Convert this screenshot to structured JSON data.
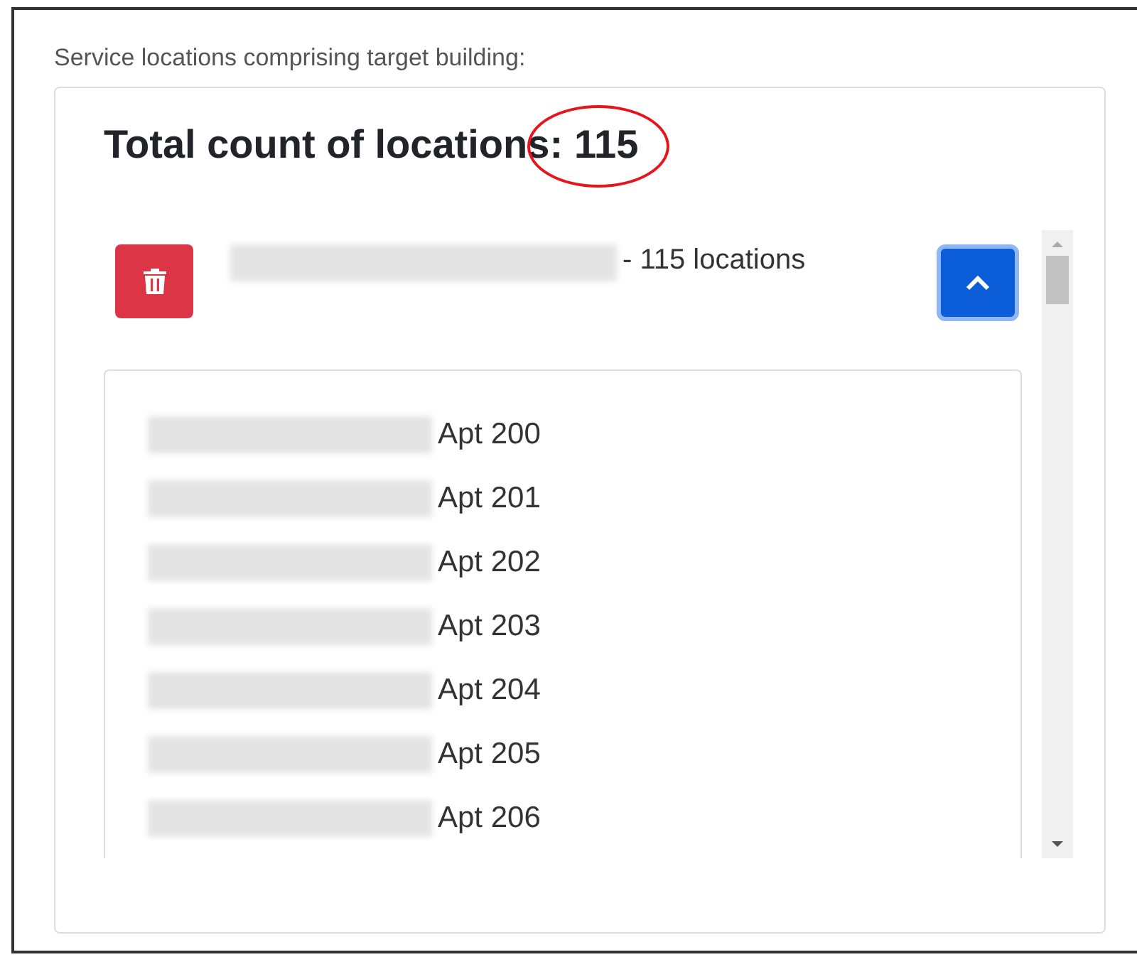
{
  "label": "Service locations comprising target building:",
  "heading": {
    "text": "Total count of locations:",
    "count": "115",
    "count_circled": true
  },
  "group": {
    "summary": "- 115 locations",
    "expanded": true,
    "items": [
      {
        "text": "Apt 200"
      },
      {
        "text": "Apt 201"
      },
      {
        "text": "Apt 202"
      },
      {
        "text": "Apt 203"
      },
      {
        "text": "Apt 204"
      },
      {
        "text": "Apt 205"
      },
      {
        "text": "Apt 206"
      }
    ]
  }
}
